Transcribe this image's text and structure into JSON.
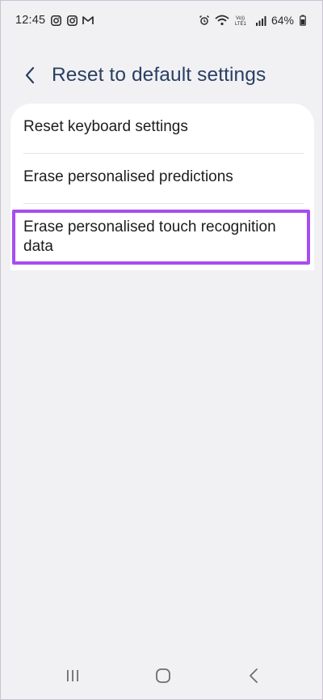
{
  "status_bar": {
    "time": "12:45",
    "left_icons": [
      "instagram-icon",
      "instagram-icon",
      "gmail-icon"
    ],
    "right_icons": [
      "alarm-icon",
      "wifi-icon",
      "volte-icon",
      "signal-icon",
      "battery-icon"
    ],
    "volte_label": "Vo))\nLTE1",
    "battery_percent": "64%"
  },
  "header": {
    "title": "Reset to default settings"
  },
  "list": {
    "items": [
      {
        "label": "Reset keyboard settings"
      },
      {
        "label": "Erase personalised predictions"
      },
      {
        "label": "Erase personalised touch recognition data",
        "highlighted": true
      }
    ]
  },
  "colors": {
    "background": "#f1f1f4",
    "title": "#2a3f63",
    "highlight_border": "#a64ef0",
    "card": "#ffffff"
  },
  "nav_bar": {
    "buttons": [
      "recents-icon",
      "home-icon",
      "back-icon"
    ]
  }
}
